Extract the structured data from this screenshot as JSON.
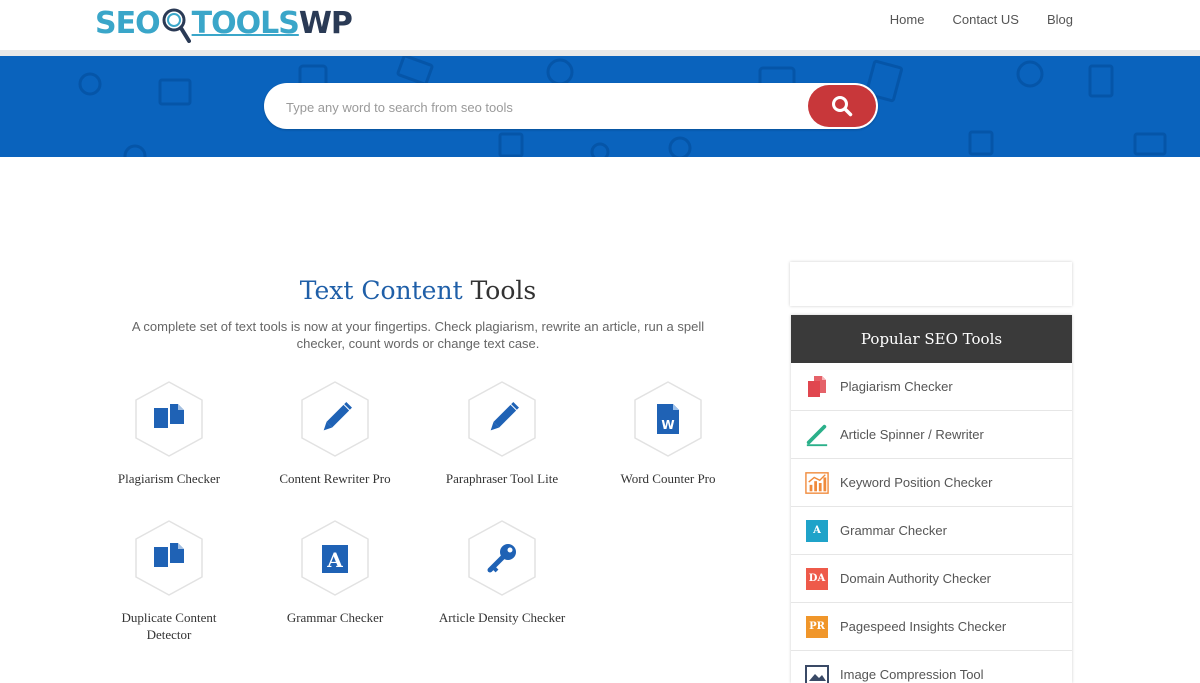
{
  "header": {
    "logo": {
      "part1": "SEO",
      "part2": "TOOLS",
      "part3": "WP"
    },
    "nav": [
      {
        "label": "Home"
      },
      {
        "label": "Contact US"
      },
      {
        "label": "Blog"
      }
    ]
  },
  "hero": {
    "search_placeholder": "Type any word to search from seo tools",
    "search_icon": "search-icon"
  },
  "section": {
    "title_highlight": "Text Content",
    "title_rest": "Tools",
    "description": "A complete set of text tools is now at your fingertips. Check plagiarism, rewrite an article, run a spell checker, count words or change text case."
  },
  "tools": [
    {
      "label": "Plagiarism Checker",
      "icon": "copy-icon"
    },
    {
      "label": "Content Rewriter Pro",
      "icon": "pencil-icon"
    },
    {
      "label": "Paraphraser Tool Lite",
      "icon": "pencil-icon"
    },
    {
      "label": "Word Counter Pro",
      "icon": "word-doc-icon"
    },
    {
      "label": "Duplicate Content Detector",
      "icon": "copy-icon"
    },
    {
      "label": "Grammar Checker",
      "icon": "letter-a-icon"
    },
    {
      "label": "Article Density Checker",
      "icon": "key-icon"
    }
  ],
  "sidebar": {
    "popular_title": "Popular SEO Tools",
    "items": [
      {
        "label": "Plagiarism Checker",
        "icon": "copy-icon",
        "color": "#e0464f"
      },
      {
        "label": "Article Spinner / Rewriter",
        "icon": "pen-icon",
        "color": "#2bb08a"
      },
      {
        "label": "Keyword Position Checker",
        "icon": "chart-icon",
        "color": "#f08a3b"
      },
      {
        "label": "Grammar Checker",
        "icon": "book-icon",
        "color": "#1fa3c9",
        "badge": "A"
      },
      {
        "label": "Domain Authority Checker",
        "icon": "da-icon",
        "color": "#ee5a4a",
        "badge": "DA"
      },
      {
        "label": "Pagespeed Insights Checker",
        "icon": "pr-icon",
        "color": "#f0962a",
        "badge": "PR"
      },
      {
        "label": "Image Compression Tool",
        "icon": "image-icon",
        "color": "#3a4a66"
      }
    ]
  }
}
